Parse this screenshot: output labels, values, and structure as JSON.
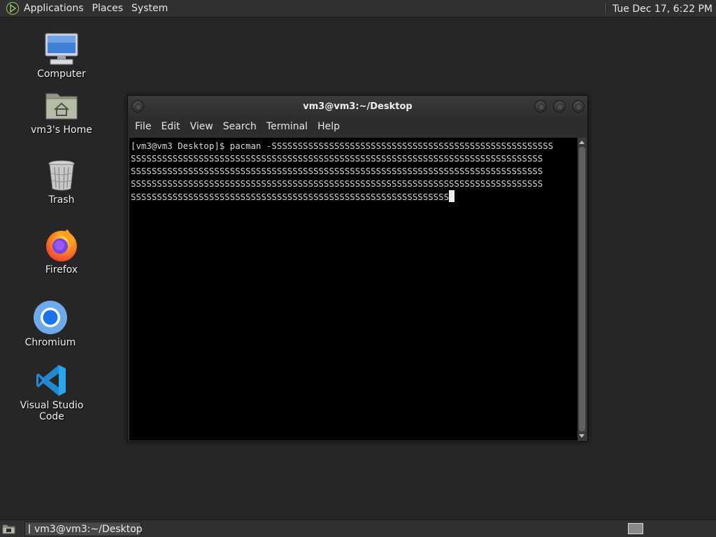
{
  "top_panel": {
    "menus": [
      "Applications",
      "Places",
      "System"
    ],
    "clock": "Tue Dec 17,  6:22 PM"
  },
  "desktop_icons": {
    "computer": "Computer",
    "home": "vm3's Home",
    "trash": "Trash",
    "firefox": "Firefox",
    "chromium": "Chromium",
    "vscode": "Visual Studio Code"
  },
  "terminal": {
    "title": "vm3@vm3:~/Desktop",
    "menu": [
      "File",
      "Edit",
      "View",
      "Search",
      "Terminal",
      "Help"
    ],
    "lines": [
      "[vm3@vm3 Desktop]$ pacman -SSSSSSSSSSSSSSSSSSSSSSSSSSSSSSSSSSSSSSSSSSSSSSSSSSSSSS",
      "SSSSSSSSSSSSSSSSSSSSSSSSSSSSSSSSSSSSSSSSSSSSSSSSSSSSSSSSSSSSSSSSSSSSSSSSSSSSSSS",
      "SSSSSSSSSSSSSSSSSSSSSSSSSSSSSSSSSSSSSSSSSSSSSSSSSSSSSSSSSSSSSSSSSSSSSSSSSSSSSSS",
      "SSSSSSSSSSSSSSSSSSSSSSSSSSSSSSSSSSSSSSSSSSSSSSSSSSSSSSSSSSSSSSSSSSSSSSSSSSSSSSS",
      "SSSSSSSSSSSSSSSSSSSSSSSSSSSSSSSSSSSSSSSSSSSSSSSSSSSSSSSSSSSSS"
    ]
  },
  "taskbar": {
    "task_label": "vm3@vm3:~/Desktop"
  }
}
